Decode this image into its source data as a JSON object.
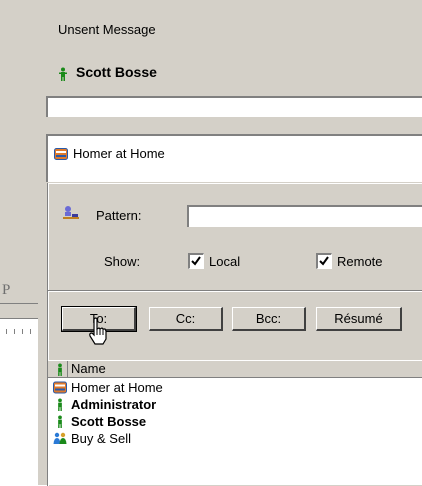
{
  "window": {
    "title": "Unsent Message"
  },
  "sender": {
    "name": "Scott Bosse",
    "icon": "person-icon"
  },
  "subject": {
    "value": ""
  },
  "recipients": [
    {
      "label": "Homer at Home",
      "icon": "address-card-icon"
    }
  ],
  "background": {
    "partial_text": "P"
  },
  "picker": {
    "pattern_label": "Pattern:",
    "pattern_value": "",
    "show_label": "Show:",
    "local_label": "Local",
    "local_checked": true,
    "remote_label": "Remote",
    "remote_checked": true,
    "buttons": {
      "to": "To:",
      "cc": "Cc:",
      "bcc": "Bcc:",
      "resume": "Résumé"
    },
    "list_header": "Name",
    "list": [
      {
        "label": "Homer at Home",
        "icon": "address-card-icon",
        "bold": false
      },
      {
        "label": "Administrator",
        "icon": "person-icon",
        "bold": true
      },
      {
        "label": "Scott Bosse",
        "icon": "person-icon",
        "bold": true
      },
      {
        "label": "Buy & Sell",
        "icon": "group-icon",
        "bold": false
      }
    ]
  },
  "colors": {
    "panel": "#d4d0c8",
    "person_green": "#1a8a1a",
    "card_blue": "#2a5aa8",
    "card_orange": "#e07a2a"
  }
}
